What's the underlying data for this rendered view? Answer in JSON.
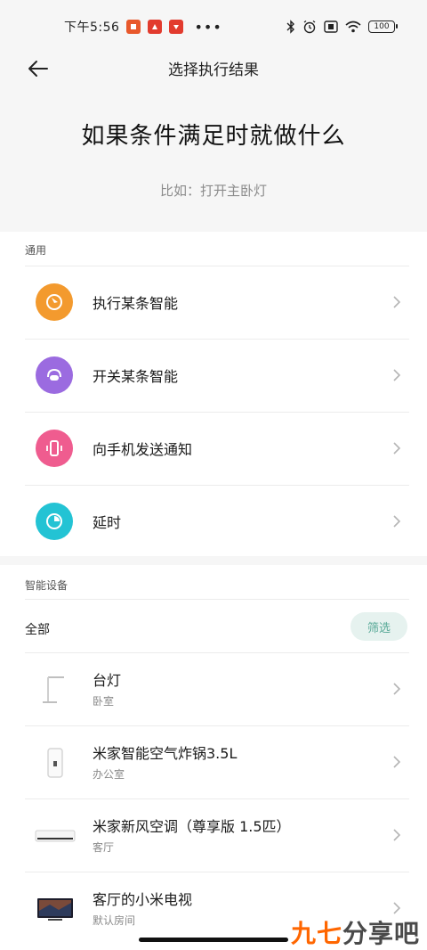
{
  "status_bar": {
    "time": "下午5:56",
    "dots": "•••",
    "battery": "100"
  },
  "header": {
    "title": "选择执行结果",
    "headline": "如果条件满足时就做什么",
    "hint": "比如：打开主卧灯"
  },
  "general": {
    "section_label": "通用",
    "items": [
      {
        "label": "执行某条智能",
        "icon": "play-scene-icon",
        "color": "#f39a2e"
      },
      {
        "label": "开关某条智能",
        "icon": "toggle-scene-icon",
        "color": "#9b6be0"
      },
      {
        "label": "向手机发送通知",
        "icon": "phone-notify-icon",
        "color": "#ef5c8f"
      },
      {
        "label": "延时",
        "icon": "timer-icon",
        "color": "#23c3d4"
      }
    ]
  },
  "devices": {
    "section_label": "智能设备",
    "filter_all": "全部",
    "filter_button": "筛选",
    "items": [
      {
        "name": "台灯",
        "room": "卧室",
        "icon": "desk-lamp-icon"
      },
      {
        "name": "米家智能空气炸锅3.5L",
        "room": "办公室",
        "icon": "air-fryer-icon"
      },
      {
        "name": "米家新风空调（尊享版 1.5匹）",
        "room": "客厅",
        "icon": "air-conditioner-icon"
      },
      {
        "name": "客厅的小米电视",
        "room": "默认房间",
        "icon": "tv-icon"
      }
    ]
  },
  "watermark": {
    "brand": "九七分享吧",
    "part_a": "九七",
    "part_b": "分享吧"
  }
}
